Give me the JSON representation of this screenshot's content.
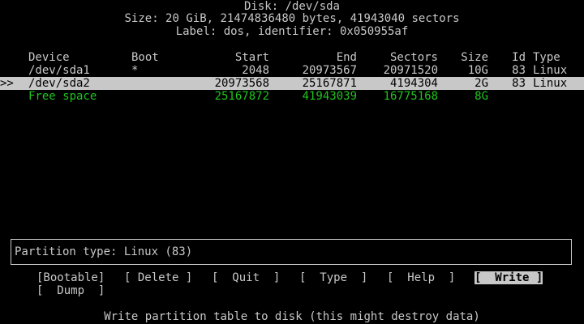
{
  "header": {
    "disk": "Disk: /dev/sda",
    "size": "Size: 20 GiB, 21474836480 bytes, 41943040 sectors",
    "label": "Label: dos, identifier: 0x050955af"
  },
  "table": {
    "columns": {
      "device": "Device",
      "boot": "Boot",
      "start": "Start",
      "end": "End",
      "sectors": "Sectors",
      "size": "Size",
      "id": "Id",
      "type": "Type"
    },
    "rows": [
      {
        "marker": "",
        "device": "/dev/sda1",
        "boot": "*",
        "start": "2048",
        "end": "20973567",
        "sectors": "20971520",
        "size": "10G",
        "id": "83",
        "type": "Linux"
      },
      {
        "marker": ">>",
        "device": "/dev/sda2",
        "boot": "",
        "start": "20973568",
        "end": "25167871",
        "sectors": "4194304",
        "size": "2G",
        "id": "83",
        "type": "Linux"
      },
      {
        "marker": "",
        "device": "Free space",
        "boot": "",
        "start": "25167872",
        "end": "41943039",
        "sectors": "16775168",
        "size": "8G",
        "id": "",
        "type": ""
      }
    ]
  },
  "info": {
    "text": "Partition type: Linux (83)"
  },
  "menu": {
    "bootable": "[Bootable]",
    "delete": "[ Delete ]",
    "quit": "[  Quit  ]",
    "type": "[  Type  ]",
    "help": "[  Help  ]",
    "write": "[  Write ]",
    "dump": "[  Dump  ]"
  },
  "status": {
    "text": "Write partition table to disk (this might destroy data)"
  },
  "colors": {
    "foreground": "#c8c8c8",
    "background": "#000000",
    "free_space": "#1fc41f",
    "highlight": "#c8c8c8"
  }
}
